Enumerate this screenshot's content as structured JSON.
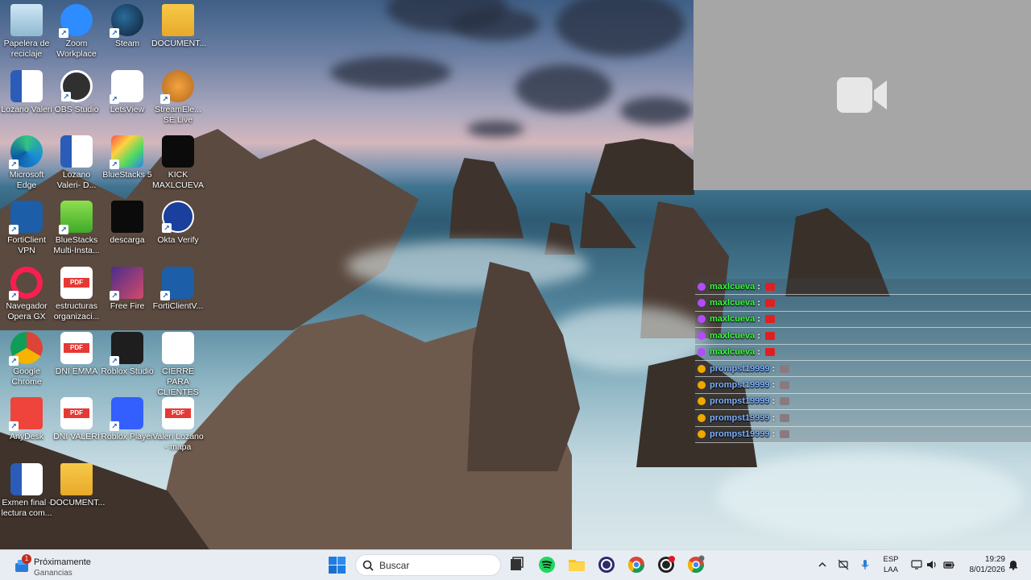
{
  "desktop": {
    "icons": [
      {
        "label": "Papelera de reciclaje",
        "icon": "recycle-bin-icon"
      },
      {
        "label": "Zoom Workplace",
        "icon": "zoom-icon"
      },
      {
        "label": "Steam",
        "icon": "steam-icon"
      },
      {
        "label": "DOCUMENT...",
        "icon": "folder-icon"
      },
      {
        "label": "Lozano Valeri",
        "icon": "word-doc-icon"
      },
      {
        "label": "OBS Studio",
        "icon": "obs-icon"
      },
      {
        "label": "LetsView",
        "icon": "letsview-icon"
      },
      {
        "label": "StreamEle... SE.Live",
        "icon": "streamelements-icon"
      },
      {
        "label": "Microsoft Edge",
        "icon": "edge-icon"
      },
      {
        "label": "Lozano Valeri- D...",
        "icon": "word-doc-icon"
      },
      {
        "label": "BlueStacks 5",
        "icon": "bluestacks-icon"
      },
      {
        "label": "KICK MAXLCUEVA",
        "icon": "kick-image-icon"
      },
      {
        "label": "FortiClient VPN",
        "icon": "forticlient-icon"
      },
      {
        "label": "BlueStacks Multi-Insta...",
        "icon": "bluestacks-multi-icon"
      },
      {
        "label": "descarga",
        "icon": "kick-logo-icon"
      },
      {
        "label": "Okta Verify",
        "icon": "okta-icon"
      },
      {
        "label": "Navegador Opera GX",
        "icon": "opera-gx-icon"
      },
      {
        "label": "estructuras organizaci...",
        "icon": "pdf-icon"
      },
      {
        "label": "Free Fire",
        "icon": "free-fire-icon"
      },
      {
        "label": "FortiClientV...",
        "icon": "forticlient-settings-icon"
      },
      {
        "label": "Google Chrome",
        "icon": "chrome-icon"
      },
      {
        "label": "DNI EMMA",
        "icon": "pdf-icon"
      },
      {
        "label": "Roblox Studio",
        "icon": "roblox-studio-icon"
      },
      {
        "label": "CIERRE PARA CLIENTES C...",
        "icon": "blank-file-icon"
      },
      {
        "label": "AnyDesk",
        "icon": "anydesk-icon"
      },
      {
        "label": "DNI VALERI",
        "icon": "pdf-icon"
      },
      {
        "label": "Roblox Player",
        "icon": "roblox-player-icon"
      },
      {
        "label": "Valeri Lozano - mapa",
        "icon": "pdf-icon"
      },
      {
        "label": "Exmen final - lectura com...",
        "icon": "word-doc-icon"
      },
      {
        "label": "DOCUMENT...",
        "icon": "folder-icon"
      }
    ]
  },
  "video_panel": {
    "icon": "video-camera-icon"
  },
  "chat": {
    "messages": [
      {
        "user": "maxlcueva",
        "sep": ":",
        "badge_color": "#b44bff",
        "emote_color": "#e02020",
        "user_color": "green"
      },
      {
        "user": "maxlcueva",
        "sep": ":",
        "badge_color": "#b44bff",
        "emote_color": "#e02020",
        "user_color": "green"
      },
      {
        "user": "maxlcueva",
        "sep": ":",
        "badge_color": "#b44bff",
        "emote_color": "#e02020",
        "user_color": "green"
      },
      {
        "user": "maxlcueva",
        "sep": ":",
        "badge_color": "#b44bff",
        "emote_color": "#e02020",
        "user_color": "green"
      },
      {
        "user": "maxlcueva",
        "sep": ":",
        "badge_color": "#b44bff",
        "emote_color": "#e02020",
        "user_color": "green"
      },
      {
        "user": "prompst19999",
        "sep": ":",
        "badge_color": "#f0a800",
        "emote_color": "#8a7a80",
        "user_color": "blue"
      },
      {
        "user": "prompst19999",
        "sep": ":",
        "badge_color": "#f0a800",
        "emote_color": "#8a7a80",
        "user_color": "blue"
      },
      {
        "user": "prompst19999",
        "sep": ":",
        "badge_color": "#f0a800",
        "emote_color": "#8a7a80",
        "user_color": "blue"
      },
      {
        "user": "prompst19999",
        "sep": ":",
        "badge_color": "#f0a800",
        "emote_color": "#8a7a80",
        "user_color": "blue"
      },
      {
        "user": "prompst19999",
        "sep": ":",
        "badge_color": "#f0a800",
        "emote_color": "#8a7a80",
        "user_color": "blue"
      }
    ]
  },
  "taskbar": {
    "widget": {
      "title": "Próximamente",
      "subtitle": "Ganancias",
      "badge": "1",
      "icon": "earnings-widget-icon"
    },
    "search_placeholder": "Buscar",
    "apps": [
      {
        "icon": "task-view-icon"
      },
      {
        "icon": "spotify-icon"
      },
      {
        "icon": "file-explorer-icon"
      },
      {
        "icon": "obs-taskbar-icon"
      },
      {
        "icon": "chrome-profile-icon"
      },
      {
        "icon": "obs-recording-icon"
      },
      {
        "icon": "chrome-taskbar-icon"
      }
    ],
    "tray": {
      "lang_line1": "ESP",
      "lang_line2": "LAA",
      "time": "19:29",
      "date": "8/01/2026"
    }
  },
  "colors": {
    "chat_green": "#3dff3d",
    "chat_blue": "#7fb2ff",
    "taskbar_bg": "#e8edf3",
    "video_panel_bg": "#a6a6a6"
  }
}
